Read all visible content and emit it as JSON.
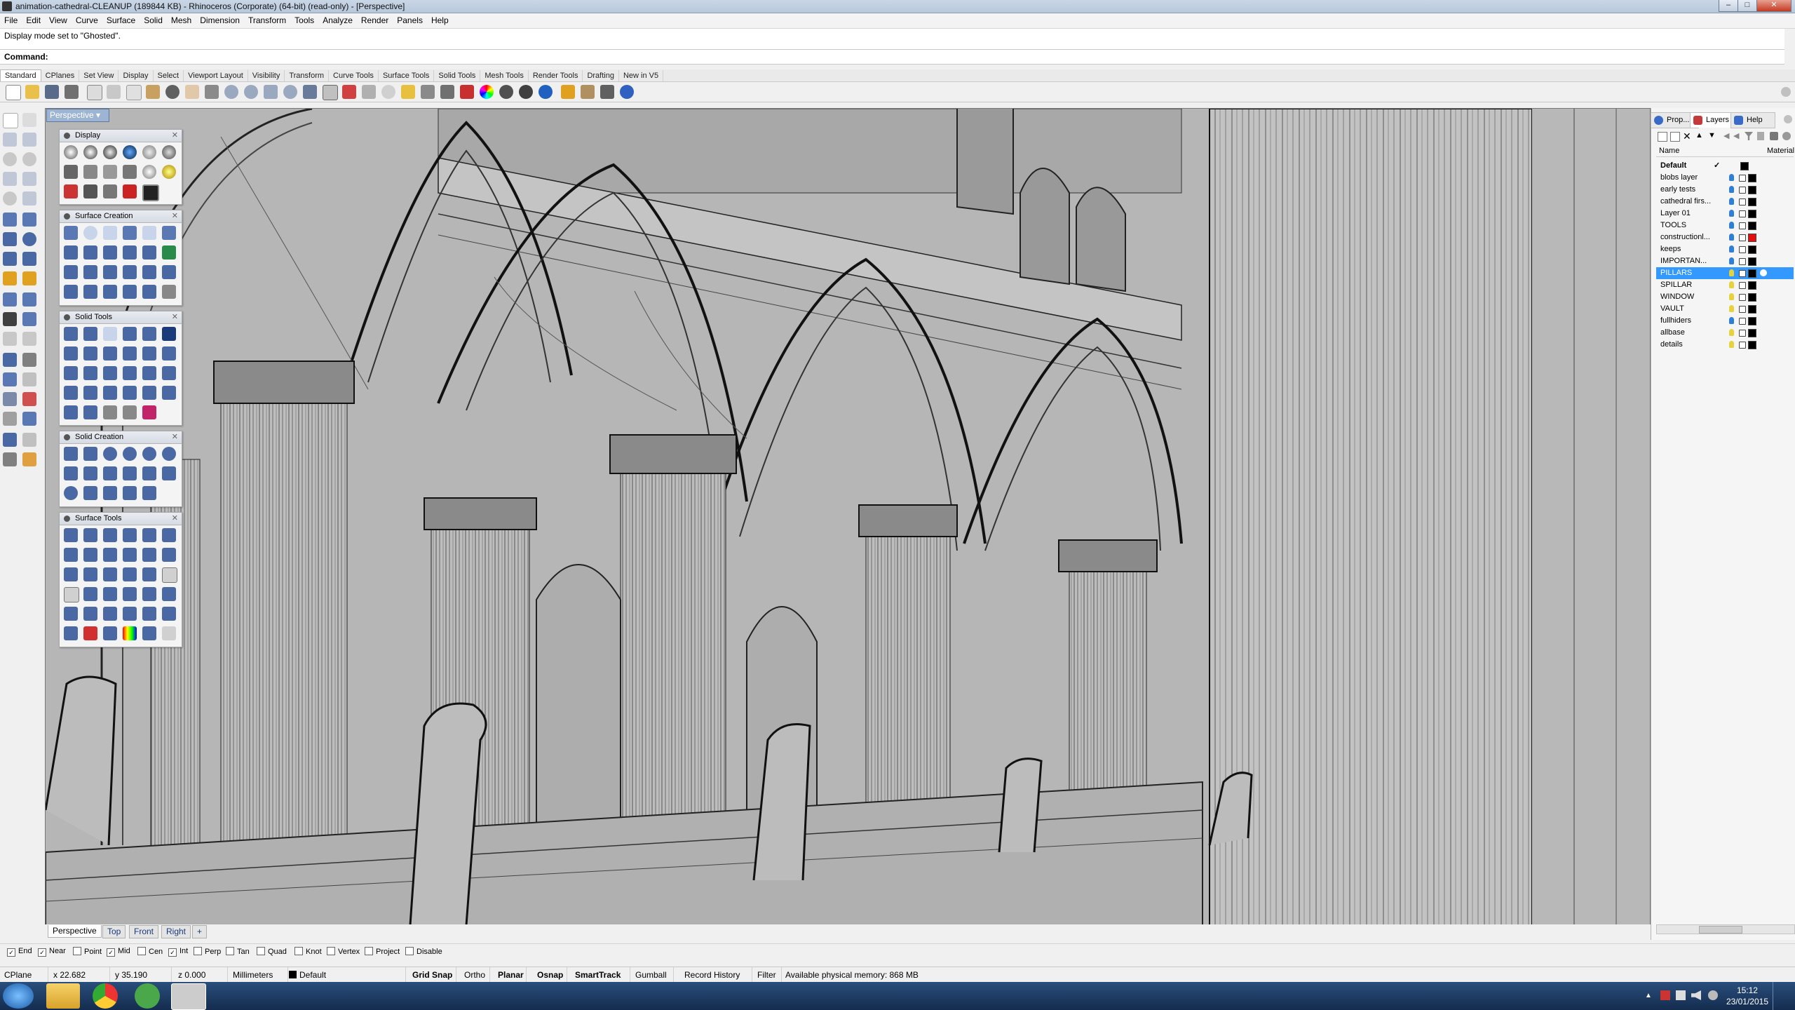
{
  "window": {
    "title": "animation-cathedral-CLEANUP (189844 KB) - Rhinoceros (Corporate) (64-bit) (read-only) - [Perspective]"
  },
  "menu": [
    "File",
    "Edit",
    "View",
    "Curve",
    "Surface",
    "Solid",
    "Mesh",
    "Dimension",
    "Transform",
    "Tools",
    "Analyze",
    "Render",
    "Panels",
    "Help"
  ],
  "history": {
    "message": "Display mode set to \"Ghosted\"."
  },
  "command": {
    "label": "Command:"
  },
  "toolbar_tabs": [
    "Standard",
    "CPlanes",
    "Set View",
    "Display",
    "Select",
    "Viewport Layout",
    "Visibility",
    "Transform",
    "Curve Tools",
    "Surface Tools",
    "Solid Tools",
    "Mesh Tools",
    "Render Tools",
    "Drafting",
    "New in V5"
  ],
  "viewport": {
    "title": "Perspective"
  },
  "floating_panels": [
    {
      "title": "Display"
    },
    {
      "title": "Surface Creation"
    },
    {
      "title": "Solid Tools"
    },
    {
      "title": "Solid Creation"
    },
    {
      "title": "Surface Tools"
    }
  ],
  "right_panel": {
    "tabs": [
      "Prop...",
      "Layers",
      "Help"
    ],
    "columns": {
      "name": "Name",
      "material": "Material"
    },
    "layers": [
      {
        "name": "Default",
        "current": true,
        "visible": true,
        "color": "#000000"
      },
      {
        "name": "blobs layer",
        "visible": true,
        "color": "#000000"
      },
      {
        "name": "early tests",
        "visible": true,
        "color": "#000000"
      },
      {
        "name": "cathedral firs...",
        "visible": true,
        "color": "#000000"
      },
      {
        "name": "Layer 01",
        "visible": true,
        "color": "#000000"
      },
      {
        "name": "TOOLS",
        "visible": true,
        "color": "#000000"
      },
      {
        "name": "constructionl...",
        "visible": true,
        "color": "#e01010"
      },
      {
        "name": "keeps",
        "visible": true,
        "color": "#000000"
      },
      {
        "name": "IMPORTAN...",
        "visible": true,
        "color": "#000000"
      },
      {
        "name": "PILLARS",
        "visible": true,
        "selected": true,
        "color": "#000000"
      },
      {
        "name": "SPILLAR",
        "visible": true,
        "color": "#000000"
      },
      {
        "name": "WINDOW",
        "visible": true,
        "color": "#000000"
      },
      {
        "name": "VAULT",
        "visible": true,
        "color": "#000000"
      },
      {
        "name": "fullhiders",
        "visible": true,
        "color": "#000000"
      },
      {
        "name": "allbase",
        "visible": true,
        "color": "#000000"
      },
      {
        "name": "details",
        "visible": true,
        "color": "#000000"
      }
    ]
  },
  "viewport_tabs": [
    "Perspective",
    "Top",
    "Front",
    "Right"
  ],
  "osnaps": [
    {
      "label": "End",
      "checked": true
    },
    {
      "label": "Near",
      "checked": true
    },
    {
      "label": "Point",
      "checked": false
    },
    {
      "label": "Mid",
      "checked": true
    },
    {
      "label": "Cen",
      "checked": false
    },
    {
      "label": "Int",
      "checked": true
    },
    {
      "label": "Perp",
      "checked": false
    },
    {
      "label": "Tan",
      "checked": false
    },
    {
      "label": "Quad",
      "checked": false
    },
    {
      "label": "Knot",
      "checked": false
    },
    {
      "label": "Vertex",
      "checked": false
    },
    {
      "label": "Project",
      "checked": false
    },
    {
      "label": "Disable",
      "checked": false
    }
  ],
  "status": {
    "cplane": "CPlane",
    "x": "x 22.682",
    "y": "y 35.190",
    "z": "z 0.000",
    "units": "Millimeters",
    "layer": "Default",
    "grid_snap": "Grid Snap",
    "ortho": "Ortho",
    "planar": "Planar",
    "osnap": "Osnap",
    "smarttrack": "SmartTrack",
    "gumball": "Gumball",
    "record_history": "Record History",
    "filter": "Filter",
    "memory": "Available physical memory: 868 MB"
  },
  "clock": {
    "time": "15:12",
    "date": "23/01/2015"
  },
  "colors": {
    "accent": "#3399ff",
    "viewport_bg": "#b4b4b4",
    "taskbar": "#1c3a62"
  }
}
